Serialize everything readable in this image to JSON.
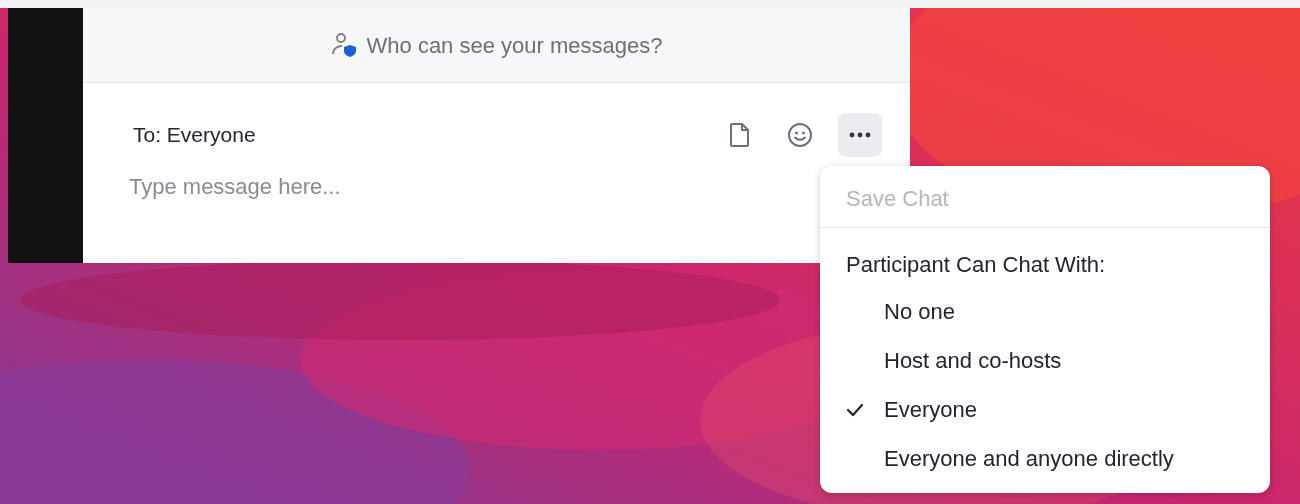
{
  "privacy_banner": {
    "text": "Who can see your messages?"
  },
  "composer": {
    "recipient": "To: Everyone",
    "placeholder": "Type message here..."
  },
  "toolbar": [
    {
      "kind": "file",
      "selected": false
    },
    {
      "kind": "emoji",
      "selected": false
    },
    {
      "kind": "more",
      "selected": true
    }
  ],
  "menu": {
    "save_chat": {
      "label": "Save Chat",
      "disabled": true
    },
    "section_title": "Participant Can Chat With:",
    "options": [
      {
        "label": "No one",
        "selected": false
      },
      {
        "label": "Host and co-hosts",
        "selected": false
      },
      {
        "label": "Everyone",
        "selected": true
      },
      {
        "label": "Everyone and anyone directly",
        "selected": false
      }
    ]
  }
}
